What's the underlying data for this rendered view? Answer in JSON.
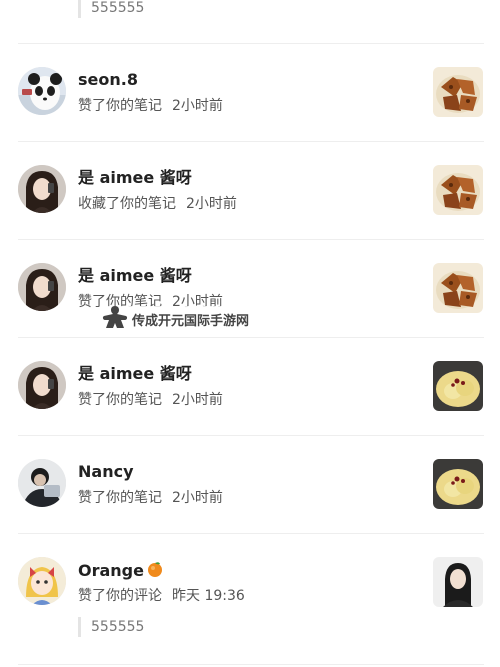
{
  "top_item": {
    "quote": "555555"
  },
  "notifications": [
    {
      "username": "seon.8",
      "action": "赞了你的笔记",
      "time": "2小时前",
      "avatar_icon": "panda-avatar",
      "thumb_icon": "fried-food-thumbnail"
    },
    {
      "username": "是 aimee 酱呀",
      "action": "收藏了你的笔记",
      "time": "2小时前",
      "avatar_icon": "girl-avatar",
      "thumb_icon": "fried-food-thumbnail"
    },
    {
      "username": "是 aimee 酱呀",
      "action": "赞了你的笔记",
      "time": "2小时前",
      "avatar_icon": "girl-avatar",
      "thumb_icon": "fried-food-thumbnail"
    },
    {
      "username": "是 aimee 酱呀",
      "action": "赞了你的笔记",
      "time": "2小时前",
      "avatar_icon": "girl-avatar",
      "thumb_icon": "pear-dessert-thumbnail"
    },
    {
      "username": "Nancy",
      "action": "赞了你的笔记",
      "time": "2小时前",
      "avatar_icon": "person-avatar",
      "thumb_icon": "pear-dessert-thumbnail"
    },
    {
      "username": "Orange",
      "username_emoji": "orange-emoji",
      "action": "赞了你的评论",
      "time": "昨天 19:36",
      "avatar_icon": "anime-girl-avatar",
      "thumb_icon": "portrait-thumbnail",
      "quote": "555555"
    }
  ],
  "watermark": {
    "text": "传成开元国际手游网",
    "icon": "meeple-icon"
  }
}
